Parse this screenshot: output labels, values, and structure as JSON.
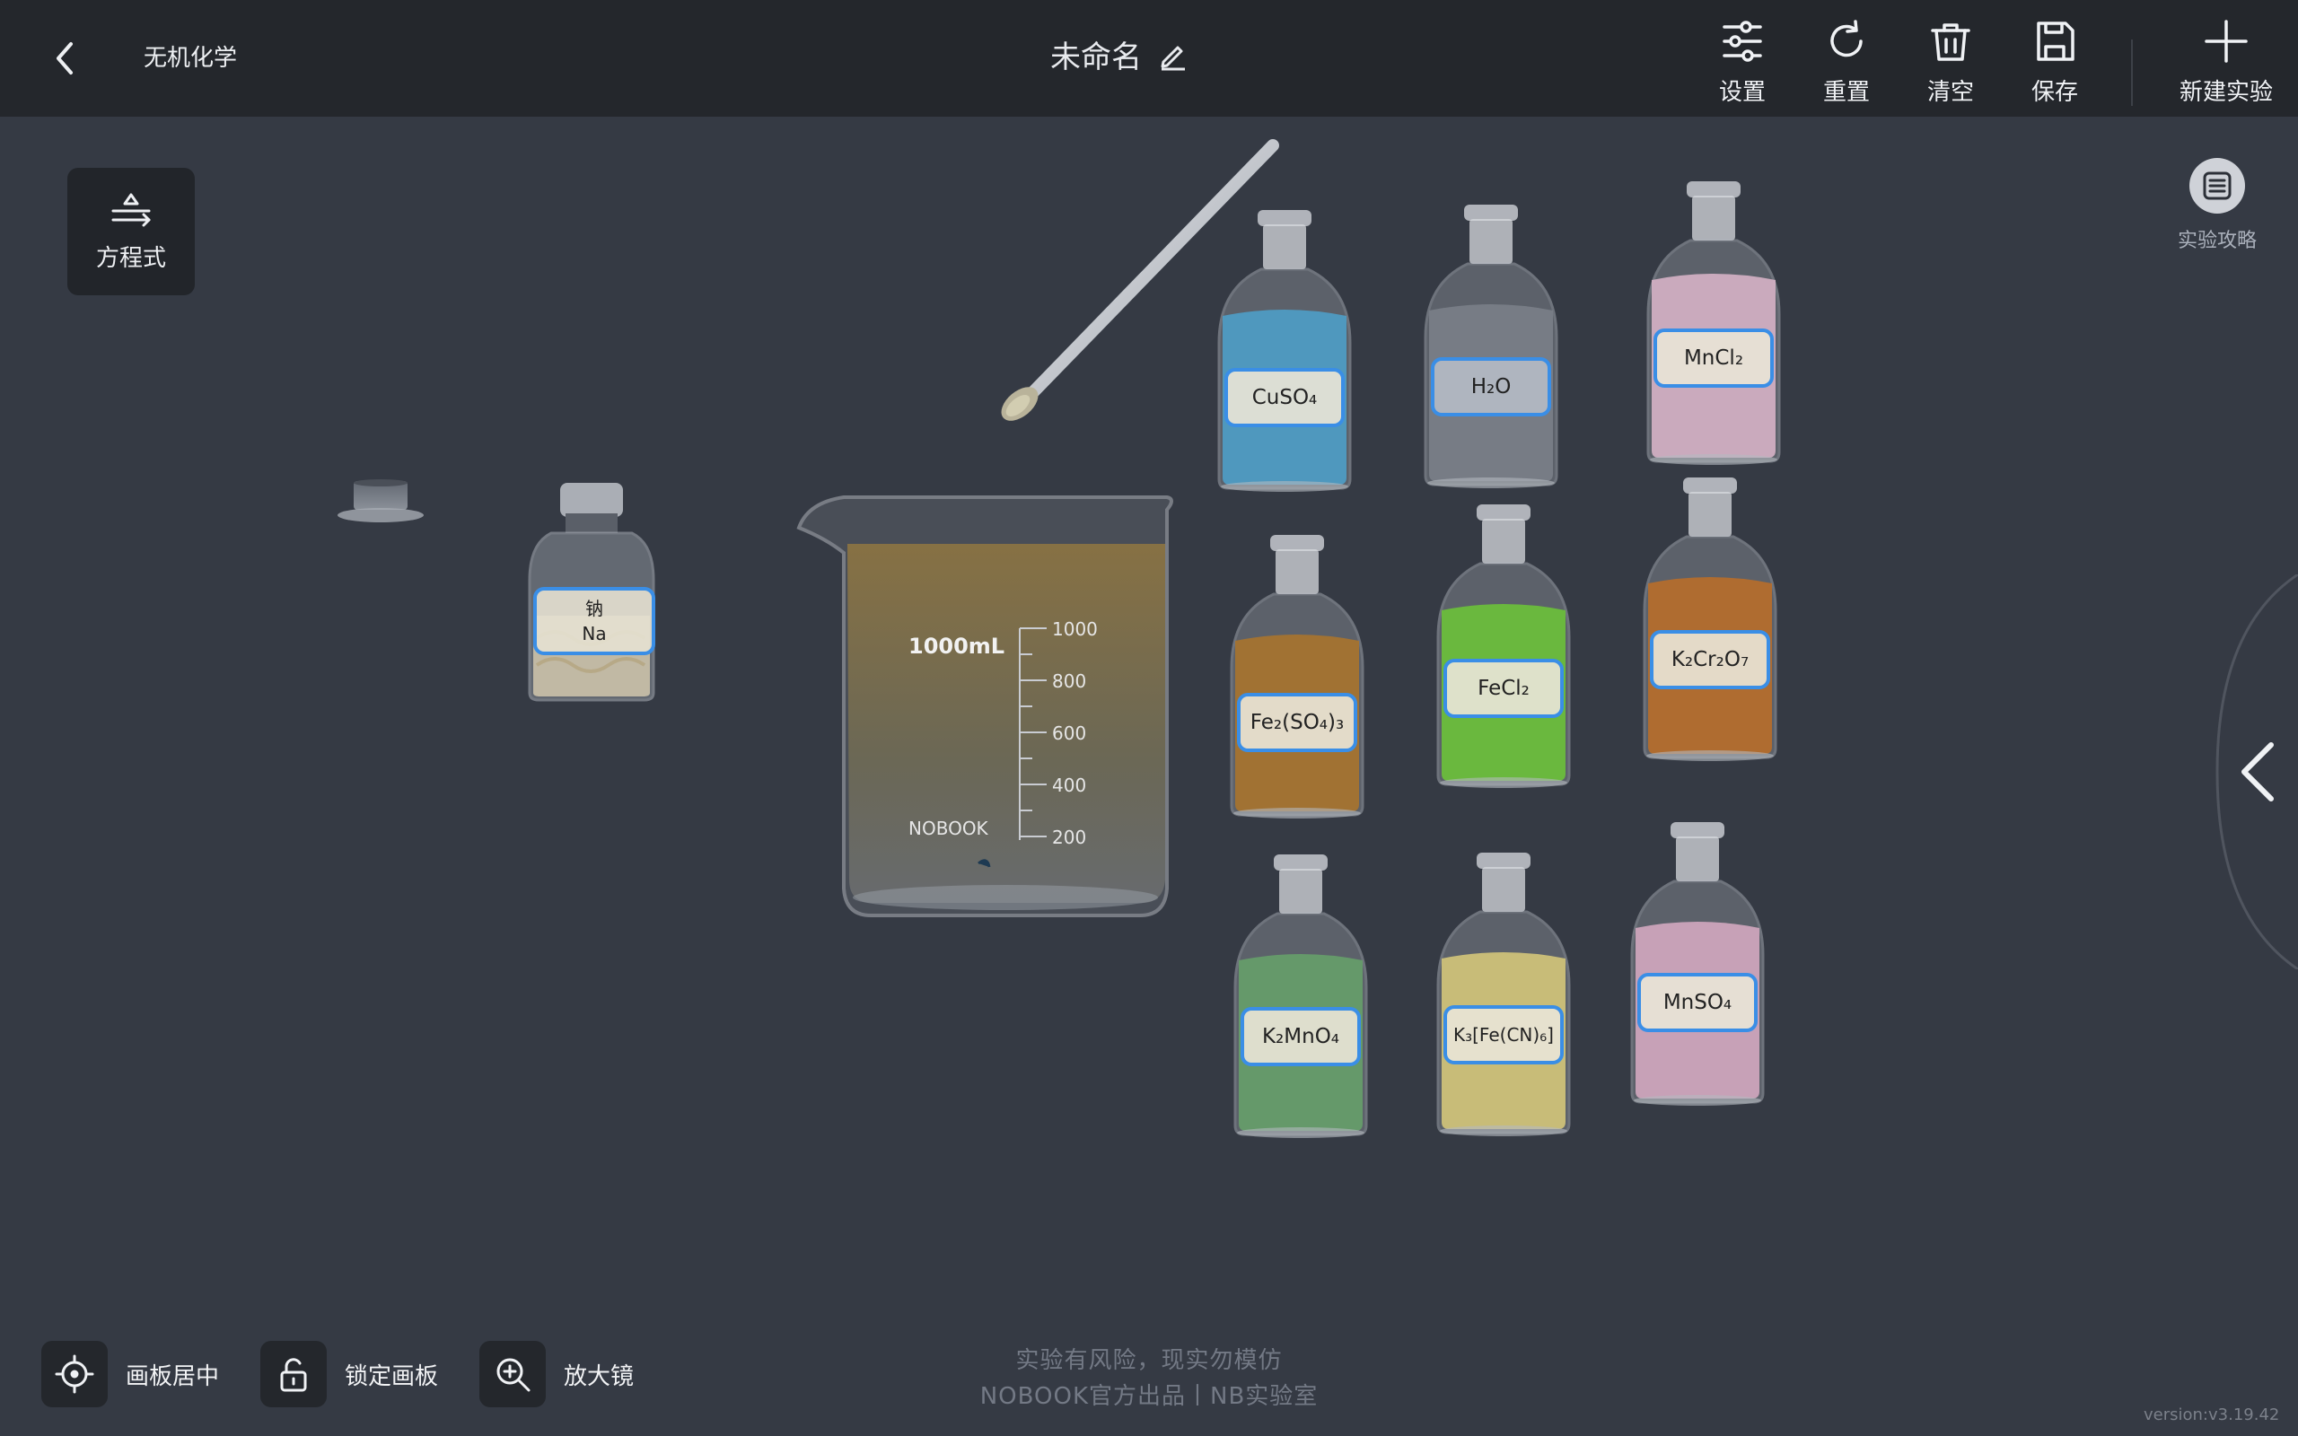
{
  "topbar": {
    "app_title": "无机化学",
    "doc_title": "未命名",
    "tools": {
      "settings": "设置",
      "reset": "重置",
      "clear": "清空",
      "save": "保存",
      "new": "新建实验"
    }
  },
  "side": {
    "equation_label": "方程式",
    "guide_label": "实验攻略"
  },
  "bottom": {
    "center_label": "画板居中",
    "lock_label": "锁定画板",
    "magnifier_label": "放大镜"
  },
  "footer": {
    "line1": "实验有风险，现实勿模仿",
    "line2": "NOBOOK官方出品丨NB实验室",
    "version": "version:v3.19.42"
  },
  "beaker": {
    "capacity_label": "1000mL",
    "brand": "NOBOOK",
    "ticks": [
      "1000",
      "800",
      "600",
      "400",
      "200"
    ]
  },
  "reagents": {
    "na": {
      "name_cn": "钠",
      "formula": "Na"
    },
    "cuso4": "CuSO₄",
    "h2o": "H₂O",
    "mncl2": "MnCl₂",
    "fe2so43": "Fe₂(SO₄)₃",
    "fecl2": "FeCl₂",
    "k2cr2o7": "K₂Cr₂O₇",
    "k2mno4": "K₂MnO₄",
    "k3fecn6": "K₃[Fe(CN)₆]",
    "mnso4": "MnSO₄"
  },
  "colors": {
    "background": "#353a44",
    "topbar": "#24272c",
    "label_border": "#3a8ee6"
  }
}
